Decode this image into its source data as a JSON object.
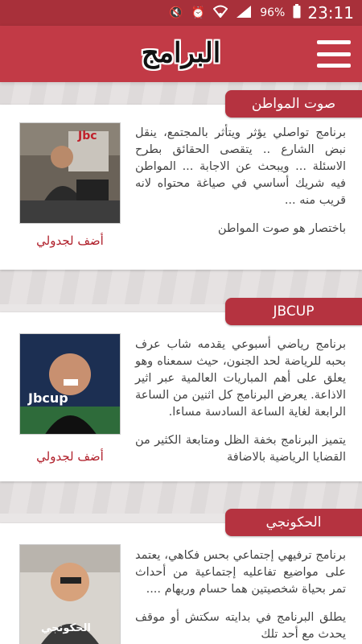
{
  "status_bar": {
    "battery": "96%",
    "time": "23:11"
  },
  "app_bar": {
    "title": "البرامج"
  },
  "programs": [
    {
      "tag": "صوت المواطن",
      "description": [
        "برنامج تواصلي يؤثر ويتأثر بالمجتمع، ينقل نبض الشارع .. يتقصى الحقائق بطرح الاسئلة ... ويبحث عن الاجابة ... المواطن فيه شريك أساسي في صياغة محتواه لانه قريب منه ...",
        "باختصار هو صوت المواطن"
      ],
      "add_label": "أضف لجدولي",
      "image_label": "Jbc"
    },
    {
      "tag": "JBCUP",
      "description": [
        "برنامج رياضي أسبوعي يقدمه شاب عرف بحبه للرياضة لحد الجنون، حيث سمعناه وهو يعلق على أهم المباريات العالمية عبر اثير الاذاعة. يعرض البرنامج كل اثنين من الساعة الرابعة لغاية الساعة السادسة مساءا.",
        "يتميز البرنامج بخفة الظل ومتابعة الكثير من القضايا الرياضية بالاضافة"
      ],
      "add_label": "أضف لجدولي",
      "image_label": "Jbcup"
    },
    {
      "tag": "الحكونجي",
      "description": [
        "برنامج ترفيهي إجتماعي بحس فكاهي، يعتمد على مواضيع تفاعليه إجتماعية من أحداث تمر بحياة شخصيتين هما حسام وريهام ....",
        "يطلق البرنامج في بدايته سكتش أو موقف يحدث مع أحد تلك"
      ],
      "add_label": "أضف لجدولي",
      "image_label": "الحكونجي"
    }
  ],
  "colors": {
    "status_bar": "#a8303a",
    "app_bar": "#c23a46",
    "tag": "#b53340",
    "add_link": "#b01f2a"
  }
}
